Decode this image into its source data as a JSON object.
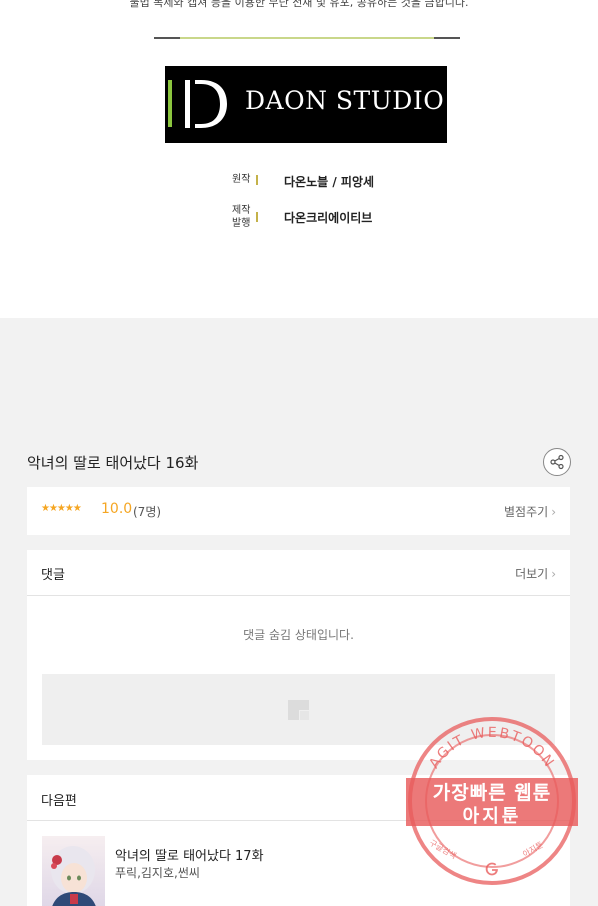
{
  "credits_area": {
    "notice": "불법 복제와 캡쳐 등을 이용한 무단 전재 및 유포, 공유하는 것을 금합니다.",
    "logo_text": "DAON STUDIO",
    "original_label": "원작",
    "original_value": "다온노블 / 피앙세",
    "production_label_1": "제작",
    "production_label_2": "발행",
    "production_value": "다온크리에이티브"
  },
  "episode": {
    "title": "악녀의 딸로 태어났다 16화",
    "share_icon": "share-icon"
  },
  "rating": {
    "stars": "★★★★★",
    "score": "10.0",
    "count": "(7명)",
    "rate_link": "별점주기",
    "colors": {
      "star": "#f5a623"
    }
  },
  "comments": {
    "heading": "댓글",
    "more_link": "더보기",
    "hidden_message": "댓글 숨김 상태입니다."
  },
  "next_episode": {
    "heading": "다음편",
    "title": "악녀의 딸로 태어났다 17화",
    "authors": "푸릭,김지호,썬씨"
  },
  "watermark": {
    "arc_text": "AGIT WEBTOON",
    "line1": "가장빠른 웹툰",
    "line2": "아지툰",
    "bottom_left": "구글검색",
    "bottom_right": "아지툰",
    "color": "#e85c5c"
  }
}
